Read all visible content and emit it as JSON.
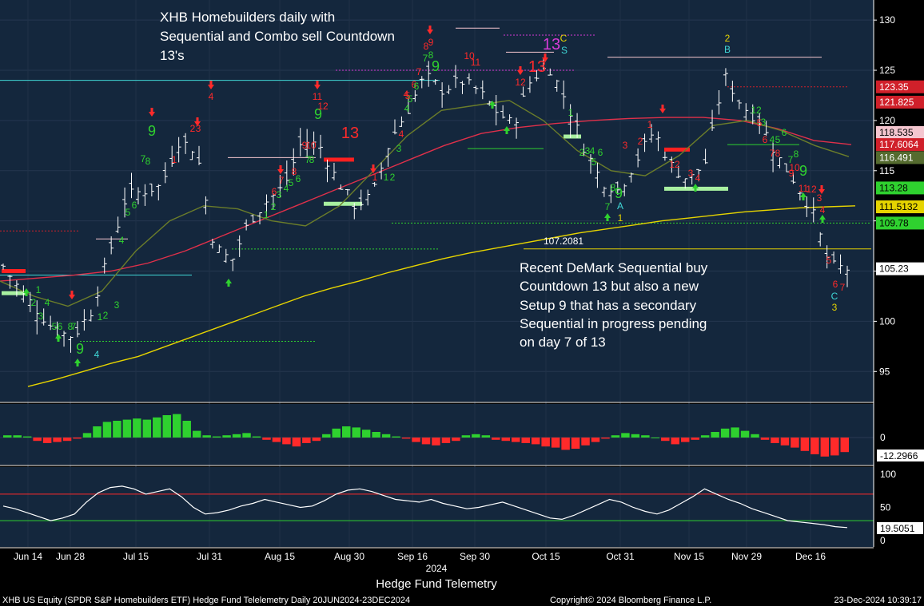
{
  "chart_data": {
    "type": "ohlc",
    "title": "XHB Homebuilders daily with Sequential and Combo sell Countdown 13's",
    "title_lines": [
      "XHB Homebuilders daily with",
      "Sequential and Combo sell Countdown",
      "13's"
    ],
    "annotation_lines": [
      "Recent DeMark Sequential buy",
      "Countdown 13 but also a new",
      "Setup 9 that has a secondary",
      "Sequential in progress pending",
      "on day 7 of 13"
    ],
    "level_label": "107.2081",
    "level_value": 107.2081,
    "x_axis": {
      "ticks": [
        "Jun 14",
        "Jun 28",
        "Jul 15",
        "Jul 31",
        "Aug 15",
        "Aug 30",
        "Sep 16",
        "Sep 30",
        "Oct 15",
        "Oct 31",
        "Nov 15",
        "Nov 29",
        "Dec 16"
      ],
      "year_label": "2024",
      "source_label": "Hedge Fund Telemetry"
    },
    "price_axis": {
      "ylim": [
        92,
        132
      ],
      "ticks": [
        95,
        100,
        105,
        110,
        115,
        120,
        125,
        130
      ]
    },
    "price_tags": [
      {
        "value": "123.35",
        "bg": "#d0202a",
        "fg": "#ffffff",
        "y": 123.35
      },
      {
        "value": "121.825",
        "bg": "#d0202a",
        "fg": "#ffffff",
        "y": 121.825
      },
      {
        "value": "118.535",
        "bg": "#f4c6cf",
        "fg": "#000000",
        "y": 118.8
      },
      {
        "value": "117.6064",
        "bg": "#d0202a",
        "fg": "#ffffff",
        "y": 117.6
      },
      {
        "value": "116.491",
        "bg": "#556b2f",
        "fg": "#ffffff",
        "y": 116.3
      },
      {
        "value": "113.28",
        "bg": "#2fd12f",
        "fg": "#000000",
        "y": 113.28
      },
      {
        "value": "111.5132",
        "bg": "#e6d400",
        "fg": "#000000",
        "y": 111.4
      },
      {
        "value": "109.78",
        "bg": "#2fd12f",
        "fg": "#000000",
        "y": 109.78
      },
      {
        "value": "105.23",
        "bg": "#ffffff",
        "fg": "#000000",
        "y": 105.23
      }
    ],
    "series": [
      {
        "name": "",
        "type": "ohlc",
        "x": [
          "2024-06-10",
          "2024-06-14",
          "2024-06-20",
          "2024-06-25",
          "2024-06-28",
          "2024-07-03",
          "2024-07-09",
          "2024-07-15",
          "2024-07-19",
          "2024-07-24",
          "2024-07-29",
          "2024-07-31",
          "2024-08-05",
          "2024-08-08",
          "2024-08-13",
          "2024-08-15",
          "2024-08-20",
          "2024-08-23",
          "2024-08-28",
          "2024-08-30",
          "2024-09-05",
          "2024-09-10",
          "2024-09-13",
          "2024-09-16",
          "2024-09-19",
          "2024-09-24",
          "2024-09-27",
          "2024-09-30",
          "2024-10-04",
          "2024-10-09",
          "2024-10-14",
          "2024-10-15",
          "2024-10-18",
          "2024-10-23",
          "2024-10-28",
          "2024-10-31",
          "2024-11-05",
          "2024-11-08",
          "2024-11-13",
          "2024-11-15",
          "2024-11-20",
          "2024-11-25",
          "2024-11-29",
          "2024-12-04",
          "2024-12-09",
          "2024-12-13",
          "2024-12-16",
          "2024-12-19",
          "2024-12-23"
        ],
        "close": [
          105.5,
          103.0,
          101.0,
          99.0,
          98.5,
          101.0,
          106.5,
          112.5,
          113.0,
          113.5,
          118.0,
          117.0,
          107.5,
          106.0,
          110.0,
          112.0,
          113.5,
          118.0,
          117.5,
          114.0,
          111.5,
          112.5,
          118.0,
          121.0,
          124.5,
          123.0,
          124.0,
          123.0,
          121.0,
          119.5,
          124.0,
          125.5,
          122.0,
          117.5,
          114.0,
          113.0,
          116.0,
          119.0,
          115.5,
          114.0,
          116.0,
          124.5,
          121.5,
          120.0,
          116.5,
          114.0,
          111.0,
          105.5,
          105.23
        ]
      },
      {
        "name": "",
        "type": "line",
        "color": "#e6d400",
        "values": [
          93.5,
          94.2,
          95.0,
          95.8,
          96.5,
          97.5,
          98.5,
          99.5,
          100.5,
          101.5,
          102.5,
          103.3,
          104.0,
          104.8,
          105.5,
          106.2,
          106.8,
          107.3,
          107.8,
          108.3,
          108.8,
          109.2,
          109.6,
          110.0,
          110.3,
          110.6,
          110.9,
          111.1,
          111.3,
          111.4,
          111.5
        ]
      },
      {
        "name": "",
        "type": "line",
        "color": "#e0304a",
        "values": [
          104.0,
          104.3,
          104.6,
          105.0,
          105.8,
          107.0,
          108.5,
          110.0,
          111.5,
          113.0,
          114.5,
          116.0,
          117.5,
          118.7,
          119.3,
          119.7,
          120.0,
          120.2,
          120.3,
          120.3,
          120.0,
          119.2,
          118.0,
          117.6
        ]
      },
      {
        "name": "",
        "type": "line",
        "color": "#6b7d2a",
        "values": [
          104.0,
          102.5,
          101.5,
          103.0,
          107.0,
          110.0,
          111.5,
          111.2,
          110.0,
          109.5,
          111.5,
          115.0,
          118.5,
          121.0,
          121.5,
          122.0,
          120.0,
          117.0,
          115.0,
          114.5,
          116.5,
          119.5,
          120.0,
          119.0,
          117.5,
          116.4
        ]
      }
    ],
    "momentum_panel": {
      "zero_label": "0",
      "last_label": "-12.2966",
      "values": [
        2,
        2,
        1,
        -3,
        -5,
        -4,
        -3,
        -1,
        4,
        10,
        14,
        15,
        16,
        17,
        16,
        18,
        20,
        21,
        15,
        6,
        2,
        1,
        2,
        3,
        4,
        1,
        -2,
        -4,
        -6,
        -8,
        -5,
        -3,
        3,
        8,
        10,
        9,
        7,
        5,
        3,
        1,
        -1,
        -4,
        -6,
        -7,
        -5,
        -3,
        2,
        3,
        2,
        -2,
        -3,
        -4,
        -5,
        -6,
        -8,
        -9,
        -11,
        -10,
        -7,
        -4,
        -1,
        2,
        4,
        3,
        2,
        0,
        -3,
        -6,
        -4,
        -2,
        2,
        5,
        8,
        9,
        6,
        3,
        -2,
        -5,
        -7,
        -9,
        -12,
        -15,
        -17,
        -16,
        -13
      ]
    },
    "rsi_panel": {
      "ticks": [
        0,
        50,
        100
      ],
      "upper": 70,
      "lower": 30,
      "last_label": "19.5051",
      "values": [
        52,
        48,
        42,
        36,
        30,
        34,
        40,
        58,
        72,
        80,
        82,
        78,
        70,
        74,
        78,
        66,
        50,
        40,
        42,
        46,
        52,
        56,
        62,
        58,
        54,
        50,
        52,
        60,
        70,
        76,
        78,
        74,
        68,
        62,
        60,
        58,
        62,
        56,
        52,
        48,
        50,
        54,
        58,
        52,
        46,
        40,
        34,
        32,
        38,
        46,
        54,
        62,
        58,
        50,
        44,
        40,
        46,
        56,
        66,
        78,
        70,
        62,
        56,
        48,
        42,
        36,
        30,
        28,
        26,
        24,
        21,
        19.5
      ]
    },
    "markers": {
      "sell_arrows": 16,
      "buy_arrows": 14
    },
    "footer": {
      "left": "XHB US Equity (SPDR S&P Homebuilders ETF) Hedge Fund Telelemetry  Daily 20JUN2024-23DEC2024",
      "center": "Copyright© 2024 Bloomberg Finance L.P.",
      "right": "23-Dec-2024 10:39:17"
    },
    "colors": {
      "background": "#0e1b2c",
      "panel_bg": "#142235",
      "grid": "#2a3a52",
      "sell": "#ff2a2a",
      "buy": "#2fd12f"
    }
  }
}
